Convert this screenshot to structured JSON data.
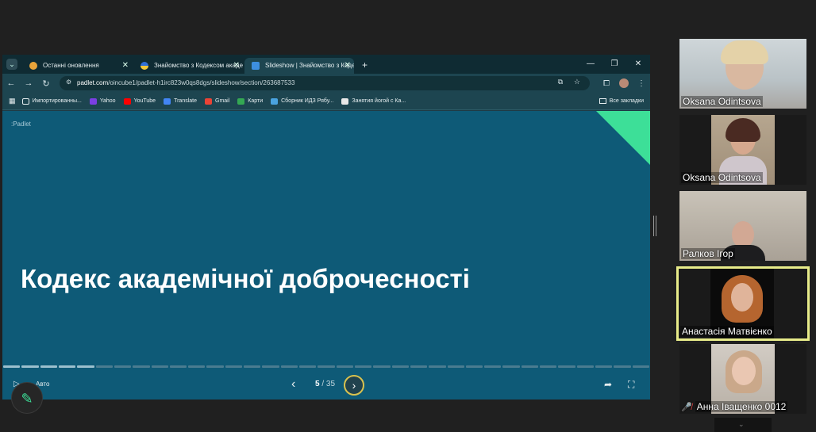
{
  "browser": {
    "tabs": [
      {
        "label": "Останні оновлення",
        "icon": "padlet-star-icon",
        "active": false
      },
      {
        "label": "Знайомство з Кодексом академ",
        "icon": "ukraine-flag-icon",
        "active": false
      },
      {
        "label": "Slideshow | Знайомство з Кодє",
        "icon": "slideshow-play-icon",
        "active": true
      }
    ],
    "new_tab_label": "+",
    "url_host": "padlet.com",
    "url_path": "/oincube1/padlet-h1irc823w0qs8dgs/slideshow/section/263687533",
    "bookmarks": [
      {
        "label": "Импортированны...",
        "icon": "folder-icon",
        "color": "#e6eef0"
      },
      {
        "label": "Yahoo",
        "icon": "yahoo-icon",
        "color": "#7b3fe4"
      },
      {
        "label": "YouTube",
        "icon": "youtube-icon",
        "color": "#ff0000"
      },
      {
        "label": "Translate",
        "icon": "translate-icon",
        "color": "#4285f4"
      },
      {
        "label": "Gmail",
        "icon": "gmail-icon",
        "color": "#ea4335"
      },
      {
        "label": "Карти",
        "icon": "maps-icon",
        "color": "#34a853"
      },
      {
        "label": "Сборник ИДЗ Рябу...",
        "icon": "doc-icon",
        "color": "#4aa3df"
      },
      {
        "label": "Занятия йогой с Ка...",
        "icon": "page-icon",
        "color": "#e8e8e8"
      }
    ],
    "all_bookmarks_label": "Все закладки"
  },
  "slide": {
    "logo": ":Padlet",
    "title": "Кодекс академічної доброчесності",
    "auto_label": "Авто",
    "current": "5",
    "separator": " / ",
    "total": "35",
    "segments_total": 35,
    "segments_done": 5,
    "accent_color": "#3ddf98"
  },
  "participants": [
    {
      "name": "Oksana Odintsova",
      "muted": false
    },
    {
      "name": "Oksana Odintsova",
      "muted": false
    },
    {
      "name": "Ралков Ігор",
      "muted": false
    },
    {
      "name": "Анастасія Матвієнко",
      "muted": false,
      "speaking": true
    },
    {
      "name": "Анна Іващенко 0012",
      "muted": true
    }
  ]
}
